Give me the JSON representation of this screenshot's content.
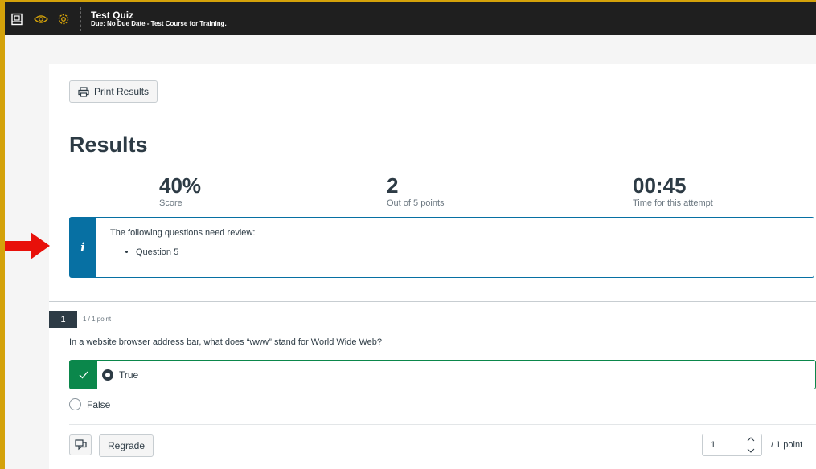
{
  "header": {
    "title": "Test Quiz",
    "subtitle": "Due: No Due Date - Test Course for Training.",
    "icons": [
      "notebook-icon",
      "eye-icon",
      "gear-icon"
    ],
    "accent_color": "#d4a20a"
  },
  "print_button": {
    "label": "Print Results",
    "icon": "printer-icon"
  },
  "results": {
    "title": "Results",
    "stats": [
      {
        "value": "40%",
        "label": "Score"
      },
      {
        "value": "2",
        "label": "Out of 5 points"
      },
      {
        "value": "00:45",
        "label": "Time for this attempt"
      }
    ]
  },
  "alert": {
    "icon": "info-icon",
    "message": "The following questions need review:",
    "items": [
      "Question 5"
    ],
    "color": "#0770a3"
  },
  "question": {
    "number": "1",
    "points": "1 / 1 point",
    "text": "In a website browser address bar, what does “www” stand for World Wide Web?",
    "answers": [
      {
        "label": "True",
        "selected": true,
        "correct": true
      },
      {
        "label": "False",
        "selected": false,
        "correct": false
      }
    ],
    "correct_color": "#0b874b",
    "regrade_label": "Regrade",
    "score_value": "1",
    "out_of": "/ 1 point"
  }
}
